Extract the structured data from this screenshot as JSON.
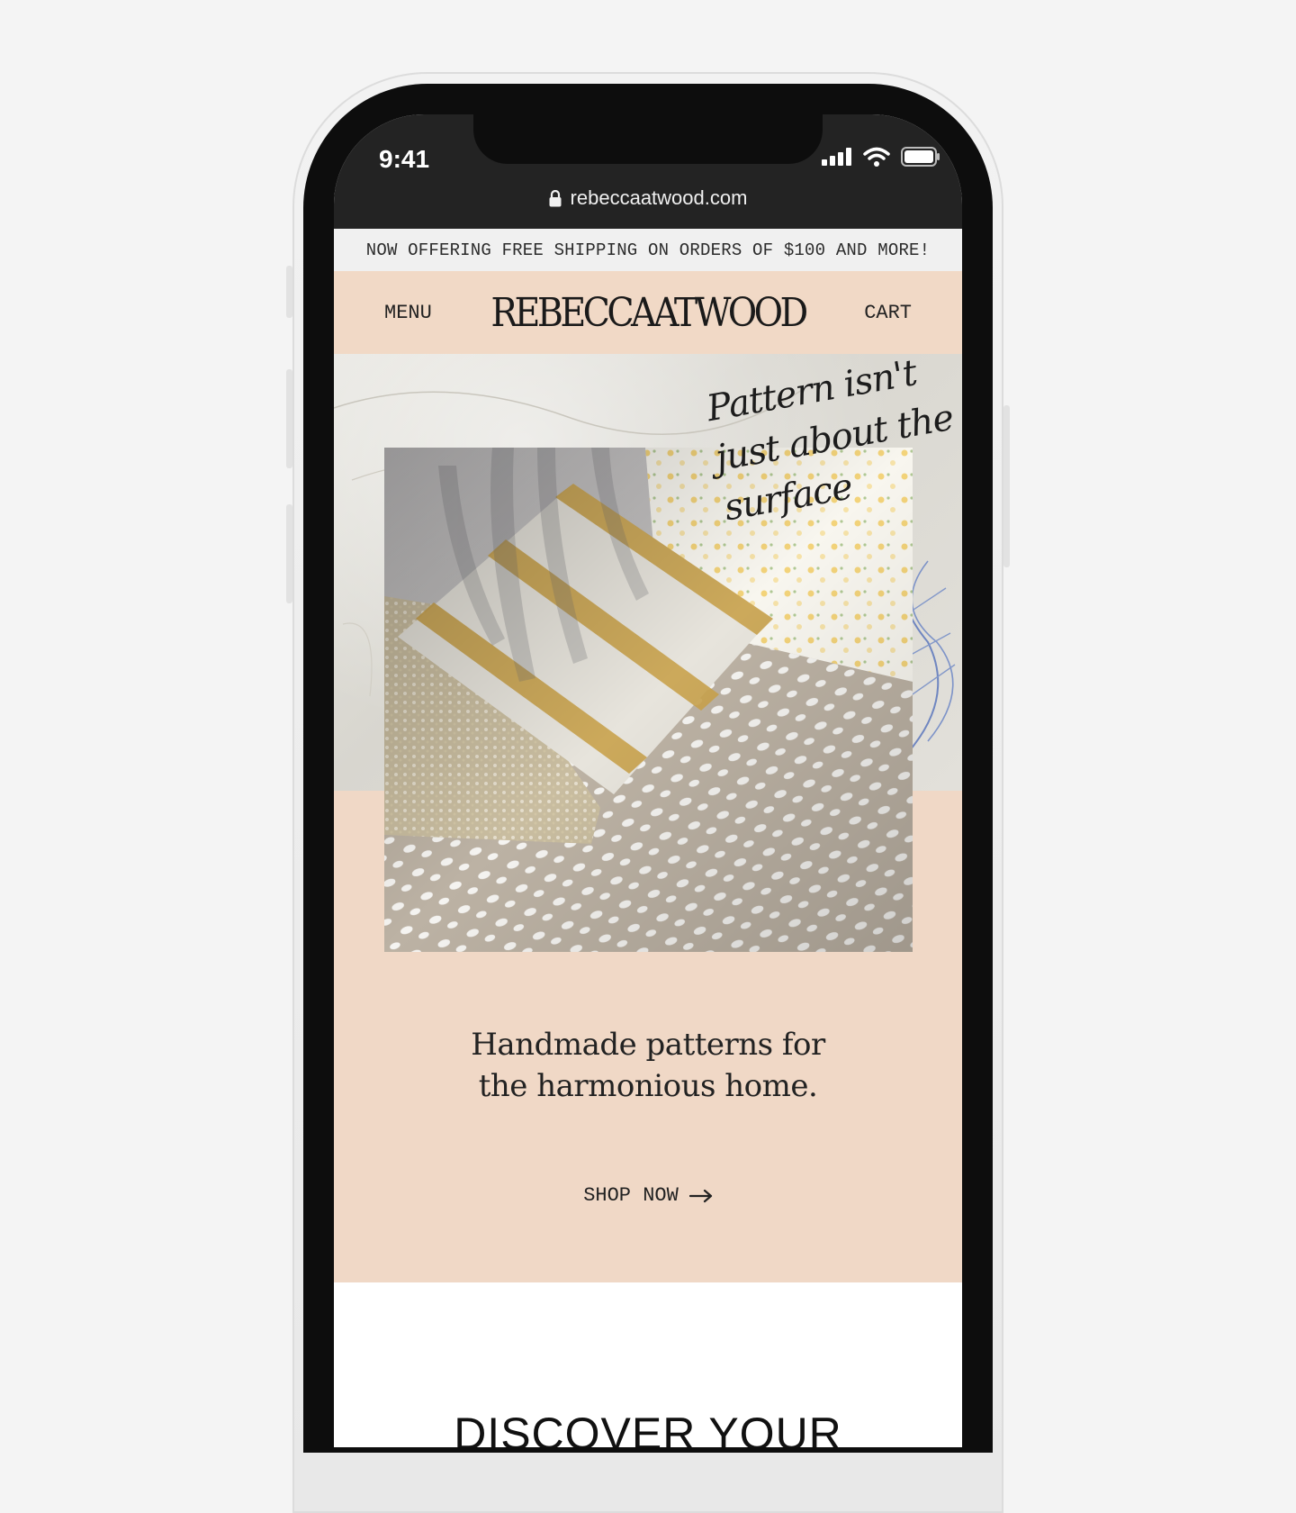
{
  "status_bar": {
    "time": "9:41",
    "url": "rebeccaatwood.com"
  },
  "announcement": "NOW OFFERING FREE SHIPPING ON ORDERS OF $100 AND MORE!",
  "nav": {
    "menu_label": "MENU",
    "logo_text": "REBECCAATWOOD",
    "cart_label": "CART"
  },
  "hero": {
    "handwriting": "Pattern isn't\njust about the\nsurface",
    "tagline_line1": "Handmade patterns for",
    "tagline_line2": "the harmonious home.",
    "cta_label": "SHOP NOW"
  },
  "section": {
    "heading": "DISCOVER YOUR"
  },
  "colors": {
    "page_bg": "#f4f4f4",
    "announce_bg": "#f0f0f0",
    "brand_peach": "#f0d8c6",
    "mustard_stripe": "#c9a24c"
  }
}
